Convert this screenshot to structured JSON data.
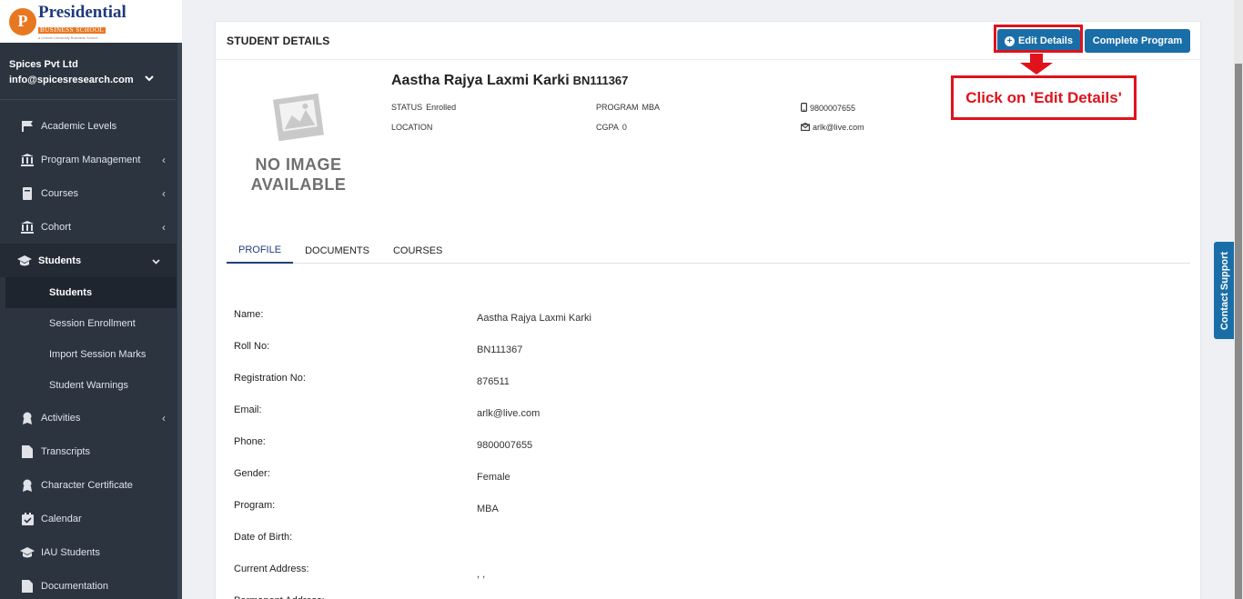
{
  "brand": {
    "mark": "P",
    "name": "Presidential",
    "sub": "BUSINESS SCHOOL",
    "tagline": "a Lincoln University Business School",
    "accent_color": "#e87722"
  },
  "org": {
    "name": "Spices Pvt Ltd",
    "email": "info@spicesresearch.com"
  },
  "sidebar": {
    "items": [
      {
        "label": "Academic Levels",
        "icon": "flag-icon"
      },
      {
        "label": "Program Management",
        "icon": "institution-icon",
        "caret": "‹"
      },
      {
        "label": "Courses",
        "icon": "book-icon",
        "caret": "‹"
      },
      {
        "label": "Cohort",
        "icon": "institution-icon",
        "caret": "‹"
      },
      {
        "label": "Students",
        "icon": "graduation-cap-icon",
        "caret": "⌄"
      },
      {
        "label": "Activities",
        "icon": "award-icon",
        "caret": "‹"
      },
      {
        "label": "Transcripts",
        "icon": "file-icon"
      },
      {
        "label": "Character Certificate",
        "icon": "award-icon"
      },
      {
        "label": "Calendar",
        "icon": "calendar-check-icon"
      },
      {
        "label": "IAU Students",
        "icon": "graduation-cap-icon"
      },
      {
        "label": "Documentation",
        "icon": "file-icon"
      }
    ],
    "students_sub": [
      {
        "label": "Students"
      },
      {
        "label": "Session Enrollment"
      },
      {
        "label": "Import Session Marks"
      },
      {
        "label": "Student Warnings"
      }
    ]
  },
  "header": {
    "title": "STUDENT DETAILS",
    "edit_label": "Edit Details",
    "complete_label": "Complete Program",
    "button_color": "#1a6ea8"
  },
  "annotation": {
    "callout": "Click on 'Edit Details'",
    "color": "#e0121c"
  },
  "student": {
    "name": "Aastha Rajya Laxmi Karki",
    "roll": "BN111367",
    "no_image_line1": "NO IMAGE",
    "no_image_line2": "AVAILABLE",
    "status_label": "STATUS",
    "status": "Enrolled",
    "program_label": "PROGRAM",
    "program": "MBA",
    "phone": "9800007655",
    "location_label": "LOCATION",
    "cgpa_label": "CGPA",
    "cgpa": "0",
    "email": "arlk@live.com"
  },
  "tabs": [
    "PROFILE",
    "DOCUMENTS",
    "COURSES"
  ],
  "profile": [
    {
      "key": "Name:",
      "value": "Aastha Rajya Laxmi Karki"
    },
    {
      "key": "Roll No:",
      "value": "BN111367"
    },
    {
      "key": "Registration No:",
      "value": "876511"
    },
    {
      "key": "Email:",
      "value": "arlk@live.com"
    },
    {
      "key": "Phone:",
      "value": "9800007655"
    },
    {
      "key": "Gender:",
      "value": "Female"
    },
    {
      "key": "Program:",
      "value": "MBA"
    },
    {
      "key": "Date of Birth:",
      "value": ""
    },
    {
      "key": "Current Address:",
      "value": ", ,"
    },
    {
      "key": "Permanent Address:",
      "value": ""
    }
  ],
  "contact_support": "Contact Support"
}
